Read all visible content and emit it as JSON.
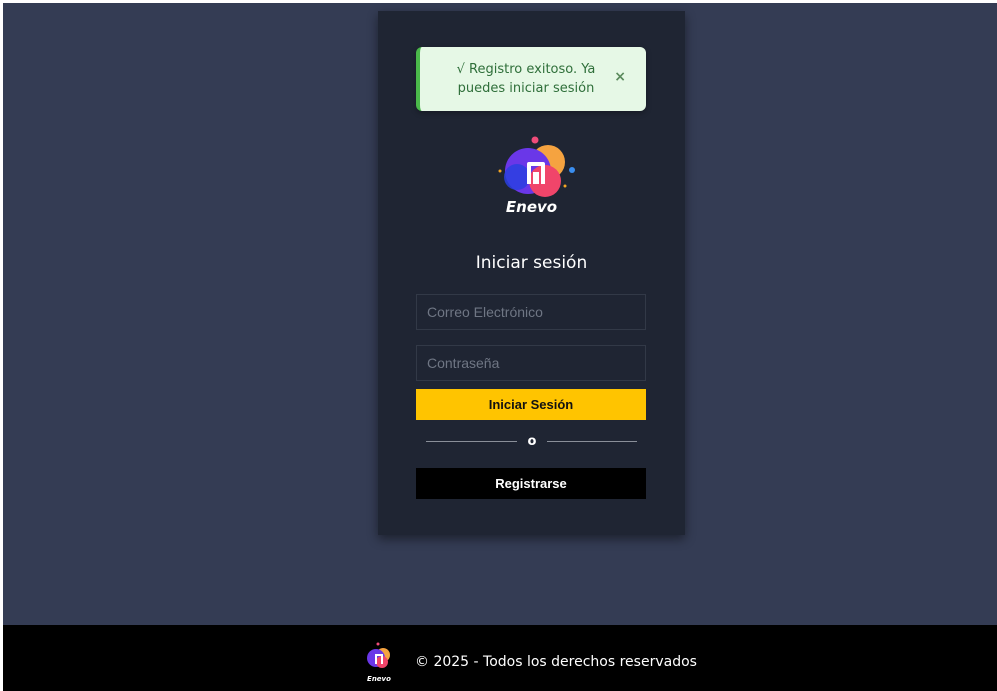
{
  "alert": {
    "message": "√ Registro exitoso. Ya puedes iniciar sesión",
    "close_symbol": "×",
    "type": "success"
  },
  "brand": {
    "name": "Enevo"
  },
  "login": {
    "title": "Iniciar sesión",
    "email_placeholder": "Correo Electrónico",
    "email_value": "",
    "password_placeholder": "Contraseña",
    "password_value": "",
    "submit_label": "Iniciar Sesión",
    "divider_text": "o",
    "register_label": "Registrarse"
  },
  "footer": {
    "copyright": "© 2025 - Todos los derechos reservados",
    "logo_text": "Enevo"
  },
  "colors": {
    "background": "#343c54",
    "card": "#1f2533",
    "primary_button": "#ffc400",
    "secondary_button": "#000000",
    "alert_bg": "#e6f8e6",
    "alert_border": "#4ab84a"
  }
}
